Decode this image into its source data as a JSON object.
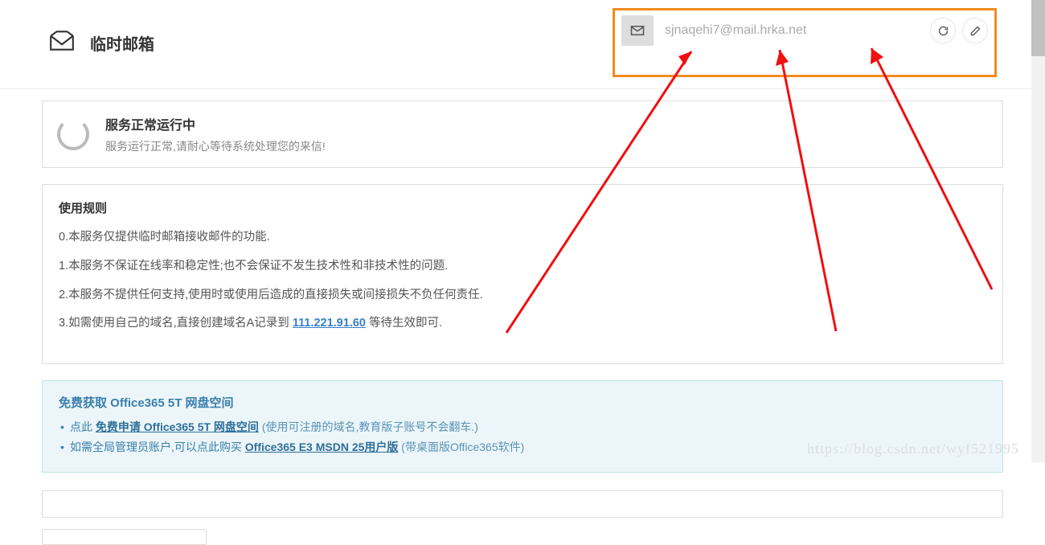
{
  "header": {
    "title": "临时邮箱",
    "email_address": "sjnaqehi7@mail.hrka.net"
  },
  "status": {
    "title": "服务正常运行中",
    "subtitle": "服务运行正常,请耐心等待系统处理您的来信!"
  },
  "rules": {
    "title": "使用规则",
    "rule0": "0.本服务仅提供临时邮箱接收邮件的功能.",
    "rule1": "1.本服务不保证在线率和稳定性;也不会保证不发生技术性和非技术性的问题.",
    "rule2": "2.本服务不提供任何支持,使用时或使用后造成的直接损失或间接损失不负任何责任.",
    "rule3_prefix": "3.如需使用自己的域名,直接创建域名A记录到 ",
    "rule3_link": "111.221.91.60",
    "rule3_suffix": " 等待生效即可."
  },
  "promo": {
    "title": "免费获取 Office365 5T 网盘空间",
    "item1_prefix": "点此 ",
    "item1_link": "免费申请 Office365 5T 网盘空间",
    "item1_suffix": " (使用可注册的域名,教育版子账号不会翻车.)",
    "item2_prefix": "如需全局管理员账户,可以点此购买 ",
    "item2_link": "Office365 E3 MSDN 25用户版",
    "item2_suffix": " (带桌面版Office365软件)"
  },
  "watermark": "https://blog.csdn.net/wyf521995"
}
